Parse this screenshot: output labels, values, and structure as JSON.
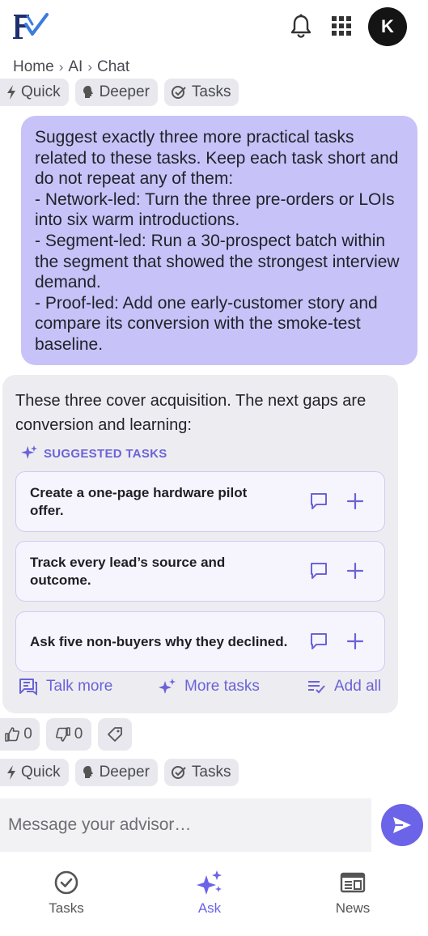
{
  "header": {
    "logo_text": "FV",
    "avatar_initial": "K",
    "icons": [
      "bell-icon",
      "apps-grid-icon"
    ]
  },
  "breadcrumb": {
    "items": [
      "Home",
      "AI",
      "Chat"
    ],
    "separator": "›"
  },
  "modes": {
    "quick": "Quick",
    "deeper": "Deeper",
    "tasks": "Tasks"
  },
  "user_message": "Suggest exactly three more practical tasks related to these tasks. Keep each task short and do not repeat any of them:\n- Network-led: Turn the three pre-orders or LOIs into six warm introductions.\n- Segment-led: Run a 30-prospect batch within the segment that showed the strongest interview demand.\n- Proof-led: Add one early-customer story and compare its conversion with the smoke-test baseline.",
  "assistant": {
    "text": "These three cover acquisition. The next gaps are conversion and learning:",
    "suggested_label": "SUGGESTED TASKS",
    "tasks": [
      {
        "text": "Create a one-page hardware pilot offer."
      },
      {
        "text": "Track every lead’s source and outcome."
      },
      {
        "text": "Ask five non-buyers why they declined."
      }
    ],
    "actions": {
      "talk_more": "Talk more",
      "more_tasks": "More tasks",
      "add_all": "Add all"
    }
  },
  "feedback": {
    "likes": "0",
    "dislikes": "0"
  },
  "composer": {
    "placeholder": "Message your advisor…"
  },
  "nav": {
    "tasks": "Tasks",
    "ask": "Ask",
    "news": "News"
  },
  "colors": {
    "accent": "#6b63e8",
    "user_bubble": "#c7c3f8",
    "assistant_bubble": "#ededf1",
    "logo_navy": "#1d2f6f",
    "logo_blue": "#3c7be0"
  }
}
